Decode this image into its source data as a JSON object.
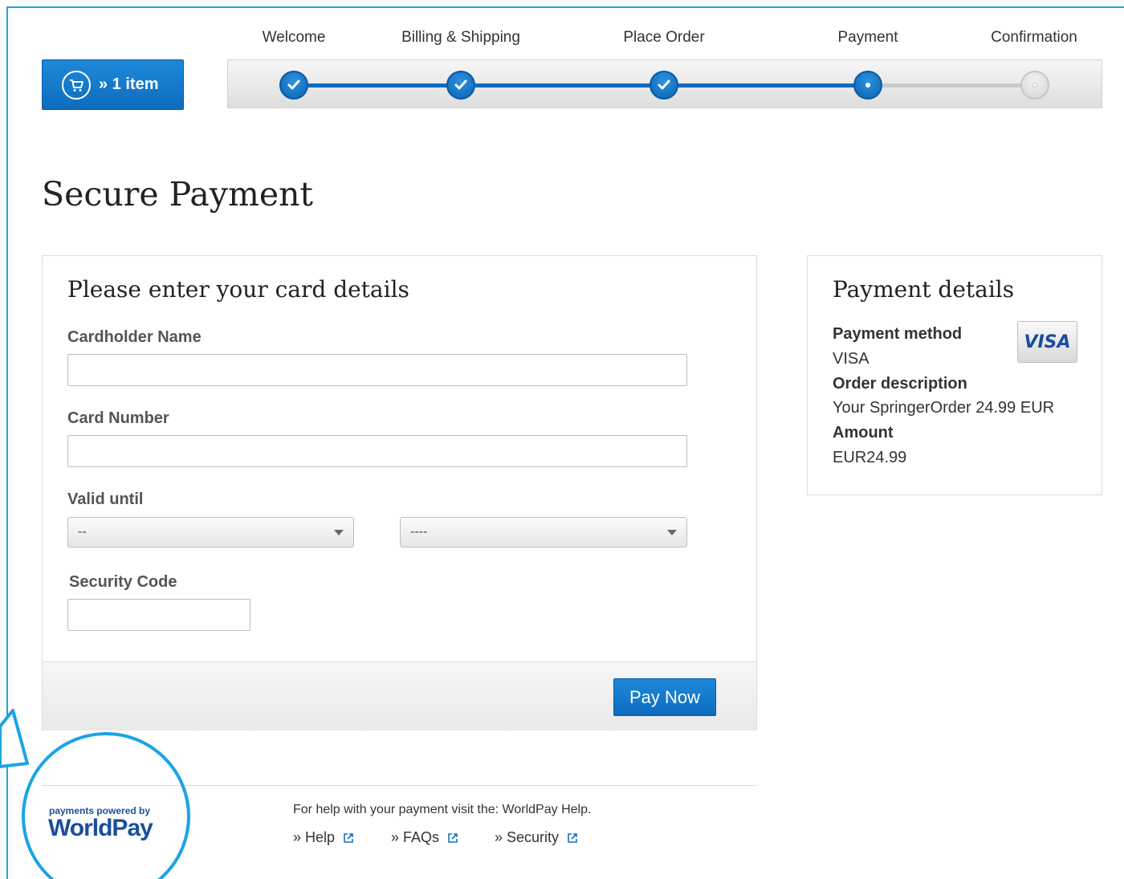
{
  "cart": {
    "label": "» 1 item",
    "icon": "cart-icon"
  },
  "steps": [
    {
      "label": "Welcome",
      "state": "done"
    },
    {
      "label": "Billing & Shipping",
      "state": "done"
    },
    {
      "label": "Place Order",
      "state": "done"
    },
    {
      "label": "Payment",
      "state": "current"
    },
    {
      "label": "Confirmation",
      "state": "todo"
    }
  ],
  "page": {
    "title": "Secure Payment"
  },
  "card_form": {
    "title": "Please enter your card details",
    "cardholder_label": "Cardholder Name",
    "cardholder_value": "",
    "card_number_label": "Card Number",
    "card_number_value": "",
    "valid_until_label": "Valid until",
    "month_selected": "--",
    "year_selected": "----",
    "security_code_label": "Security Code",
    "security_code_value": "",
    "submit_label": "Pay Now"
  },
  "payment_details": {
    "title": "Payment details",
    "method_label": "Payment method",
    "method_value": "VISA",
    "card_brand": "VISA",
    "description_label": "Order description",
    "description_value": "Your SpringerOrder 24.99 EUR",
    "amount_label": "Amount",
    "amount_value": "EUR24.99"
  },
  "footer": {
    "help_text": "For help with your payment visit the: WorldPay Help.",
    "links": [
      "» Help",
      "» FAQs",
      "» Security"
    ],
    "powered_by": "payments powered by",
    "brand": "WorldPay"
  },
  "colors": {
    "accent": "#0e6cbf",
    "callout": "#1ba4e4",
    "brand": "#1a4f9c"
  }
}
